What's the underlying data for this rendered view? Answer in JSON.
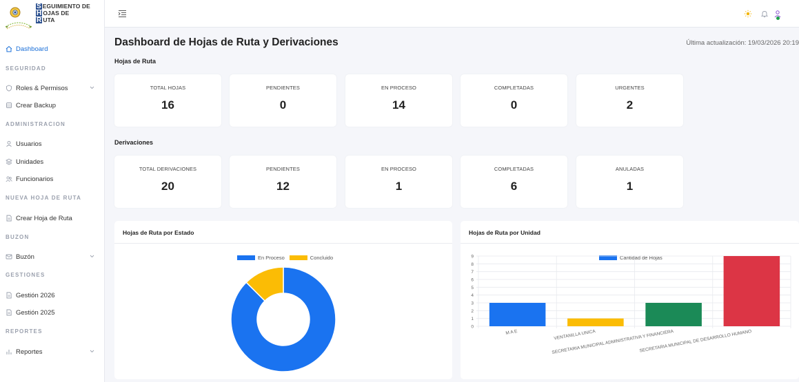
{
  "brand": {
    "line1_cap": "S",
    "line1_rest": "EGUIMIENTO DE",
    "line2_cap": "H",
    "line2_rest": "OJAS DE",
    "line3_cap": "R",
    "line3_rest": "UTA"
  },
  "sidebar": {
    "dashboard": "Dashboard",
    "sec_seguridad": "SEGURIDAD",
    "roles": "Roles & Permisos",
    "backup": "Crear Backup",
    "sec_administracion": "ADMINISTRACION",
    "usuarios": "Usuarios",
    "unidades": "Unidades",
    "funcionarios": "Funcionarios",
    "sec_nueva": "NUEVA HOJA DE RUTA",
    "crear_hoja": "Crear Hoja de Ruta",
    "sec_buzon": "BUZON",
    "buzon": "Buzón",
    "sec_gestiones": "GESTIONES",
    "gestion_2026": "Gestión 2026",
    "gestion_2025": "Gestión 2025",
    "sec_reportes": "REPORTES",
    "reportes": "Reportes"
  },
  "header": {
    "title": "Dashboard de Hojas de Ruta y Derivaciones",
    "last_update": "Última actualización: 19/03/2026 20:19"
  },
  "hojas": {
    "title": "Hojas de Ruta",
    "cards": [
      {
        "label": "TOTAL HOJAS",
        "value": "16"
      },
      {
        "label": "PENDIENTES",
        "value": "0"
      },
      {
        "label": "EN PROCESO",
        "value": "14"
      },
      {
        "label": "COMPLETADAS",
        "value": "0"
      },
      {
        "label": "URGENTES",
        "value": "2"
      }
    ]
  },
  "derivaciones": {
    "title": "Derivaciones",
    "cards": [
      {
        "label": "TOTAL DERIVACIONES",
        "value": "20"
      },
      {
        "label": "PENDIENTES",
        "value": "12"
      },
      {
        "label": "EN PROCESO",
        "value": "1"
      },
      {
        "label": "COMPLETADAS",
        "value": "6"
      },
      {
        "label": "ANULADAS",
        "value": "1"
      }
    ]
  },
  "panels": {
    "estado_title": "Hojas de Ruta por Estado",
    "unidad_title": "Hojas de Ruta por Unidad"
  },
  "colors": {
    "blue": "#1a73f0",
    "yellow": "#fbbc05",
    "green": "#1b8a57",
    "red": "#dc3545",
    "accent": "#1a6fd8"
  },
  "chart_data": [
    {
      "type": "pie",
      "variant": "doughnut",
      "categories": [
        "En Proceso",
        "Concluido"
      ],
      "values": [
        14,
        2
      ],
      "colors": [
        "#1a73f0",
        "#fbbc05"
      ],
      "legend": "top"
    },
    {
      "type": "bar",
      "categories": [
        "M A E",
        "VENTANILLA UNICA",
        "SECRETARIA MUNICIPAL ADMINISTRATIVA Y FINANCIERA",
        "SECRETARIA MUNICIPAL DE DESARROLLO HUMANO"
      ],
      "series": [
        {
          "name": "Cantidad de Hojas",
          "values": [
            3,
            1,
            3,
            9
          ]
        }
      ],
      "colors": [
        "#1a73f0",
        "#fbbc05",
        "#1b8a57",
        "#dc3545"
      ],
      "ylim": [
        0,
        9
      ],
      "yticks": [
        0,
        1,
        2,
        3,
        4,
        5,
        6,
        7,
        8,
        9
      ],
      "grid": true,
      "legend": "top"
    }
  ]
}
